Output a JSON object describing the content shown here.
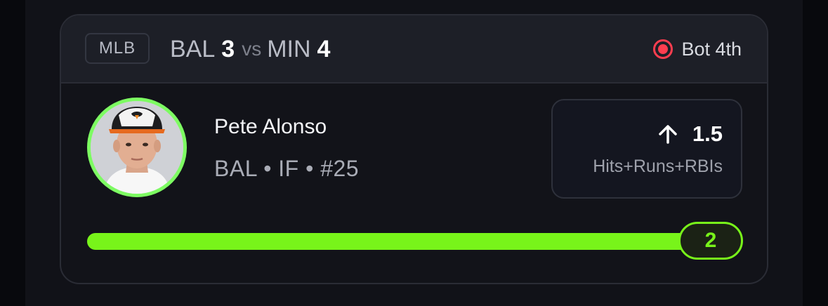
{
  "header": {
    "league": "MLB",
    "away_team": "BAL",
    "away_score": "3",
    "vs": "vs",
    "home_team": "MIN",
    "home_score": "4",
    "game_status": "Bot 4th",
    "status_icon": "live-record-icon",
    "status_color": "#ff3d4f"
  },
  "player": {
    "name": "Pete Alonso",
    "meta": "BAL • IF • #25",
    "avatar_icon": "player-headshot",
    "avatar_ring_color": "#7dfc62"
  },
  "line": {
    "direction_icon": "arrow-up-icon",
    "value": "1.5",
    "stat": "Hits+Runs+RBIs"
  },
  "progress": {
    "current": "2",
    "fill_fraction": 1.0,
    "color": "#78f41a"
  }
}
